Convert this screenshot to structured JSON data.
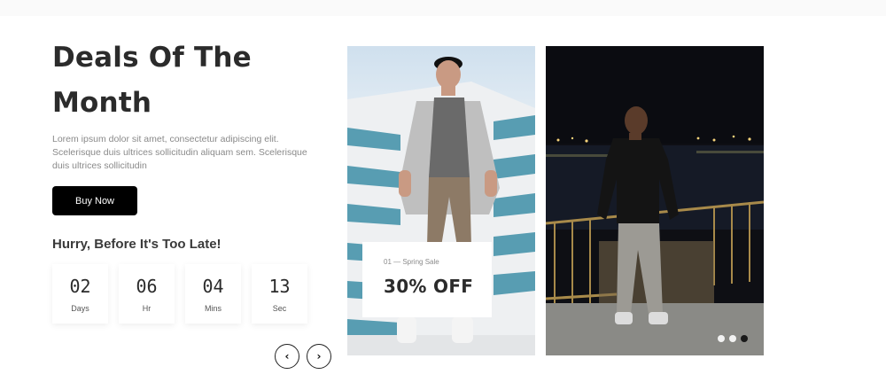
{
  "deals": {
    "title": "Deals Of The Month",
    "description": "Lorem ipsum dolor sit amet, consectetur adipiscing elit. Scelerisque duis ultrices sollicitudin aliquam sem. Scelerisque duis ultrices sollicitudin",
    "buy_button": "Buy Now",
    "hurry": "Hurry, Before It's Too Late!",
    "countdown": [
      {
        "value": "02",
        "label": "Days"
      },
      {
        "value": "06",
        "label": "Hr"
      },
      {
        "value": "04",
        "label": "Mins"
      },
      {
        "value": "13",
        "label": "Sec"
      }
    ]
  },
  "nav": {
    "prev_icon": "‹",
    "next_icon": "›"
  },
  "slider": {
    "sale_tag": "01 — Spring Sale",
    "sale_text": "30% OFF",
    "dots_count": 3,
    "active_dot": 3
  }
}
